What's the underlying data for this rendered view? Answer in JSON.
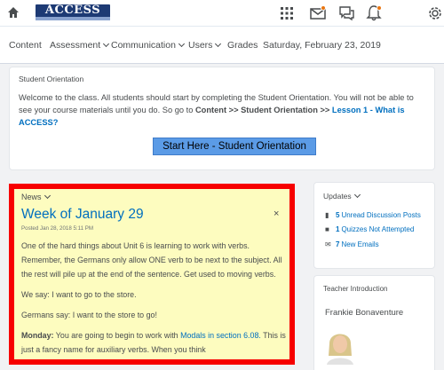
{
  "topbar": {
    "logo_text": "ACCESS",
    "icons": [
      "home-icon",
      "grid-icon",
      "mail-icon",
      "chat-icon",
      "bell-icon",
      "gear-icon"
    ],
    "accent": "#e87511"
  },
  "nav": {
    "items": [
      {
        "label": "Content",
        "dropdown": false
      },
      {
        "label": "Assessment",
        "dropdown": true
      },
      {
        "label": "Communication",
        "dropdown": true
      },
      {
        "label": "Users",
        "dropdown": true
      },
      {
        "label": "Grades",
        "dropdown": false
      },
      {
        "label": "Saturday, February 23, 2019",
        "dropdown": false
      }
    ]
  },
  "orientation": {
    "title": "Student Orientation",
    "text_1": "Welcome to the class. All students should start by completing the Student Orientation. You will not be able to see your course materials until you do. So go to ",
    "bold_1": "Content >> Student Orientation >> ",
    "link": "Lesson 1 - What is ACCESS?",
    "button_label": "Start Here - Student Orientation"
  },
  "news": {
    "header": "News",
    "title": "Week of January 29",
    "close": "×",
    "date": "Posted Jan 28, 2018 5:11 PM",
    "para1": "One of the hard things about Unit 6 is learning to work with verbs.  Remember, the Germans only allow ONE verb to be next to the subject.  All the rest will pile up at the end of the sentence.  Get used to moving verbs.",
    "para2": "We say:  I want to go to the store.",
    "para3": "Germans say:  I want to the store to go!",
    "para4_label": "Monday:",
    "para4_text": " You are going to begin to work with ",
    "para4_link": "Modals in section 6.08.",
    "para4_rest": "  This is just a fancy name for auxiliary verbs. When you think",
    "border_color": "#f70000",
    "background": "#fdfcbf"
  },
  "updates": {
    "header": "Updates",
    "rows": [
      {
        "icon": "discussion-icon",
        "count": "5",
        "label": "Unread Discussion Posts"
      },
      {
        "icon": "quiz-icon",
        "count": "1",
        "label": "Quizzes Not Attempted"
      },
      {
        "icon": "email-icon",
        "count": "7",
        "label": "New Emails"
      }
    ]
  },
  "teacher": {
    "header": "Teacher Introduction",
    "name": "Frankie Bonaventure"
  }
}
